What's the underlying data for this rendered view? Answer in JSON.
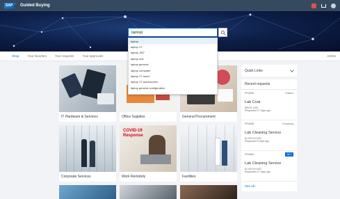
{
  "shell": {
    "logo": "SAP",
    "title": "Guided Buying"
  },
  "search": {
    "value": "laptop|",
    "suggestions": [
      "laptop",
      "laptop 1T",
      "laptop_587",
      "laptop unit",
      "laptop general",
      "laptop computer",
      "laptop 1T touch",
      "laptop 1T touchscreen",
      "laptop general configuration"
    ]
  },
  "tabs": [
    "Shop",
    "Your favorites",
    "Your requests",
    "Your approvals"
  ],
  "tab_right": "Admin",
  "tiles": [
    {
      "label": "IT Hardware & Services"
    },
    {
      "label": "Office Supplies"
    },
    {
      "label": "General Procurement"
    },
    {
      "label": "Corporate Services"
    },
    {
      "label": "Work Remotely",
      "overlay": "COVID-19 Response"
    },
    {
      "label": "Facilities"
    }
  ],
  "quick_links": "Quick Links",
  "recent": {
    "title": "Recent requests",
    "items": [
      {
        "id": "PR18806",
        "status": "Ordered",
        "name": "Lab Coat",
        "amount": "$59.91 USD",
        "when": "Requested 27 days ago"
      },
      {
        "id": "PR18808",
        "status": "Composing",
        "name": "Lab Cleaning Service",
        "amount": "$1,000.00 USD",
        "when": "Requested 5 days ago"
      },
      {
        "id": "PR18881",
        "status": "All 1",
        "name": "Lab Cleaning Service",
        "amount": "$1,000.00 USD",
        "when": "Requested 27 days ago"
      }
    ],
    "see_all": "See all"
  }
}
